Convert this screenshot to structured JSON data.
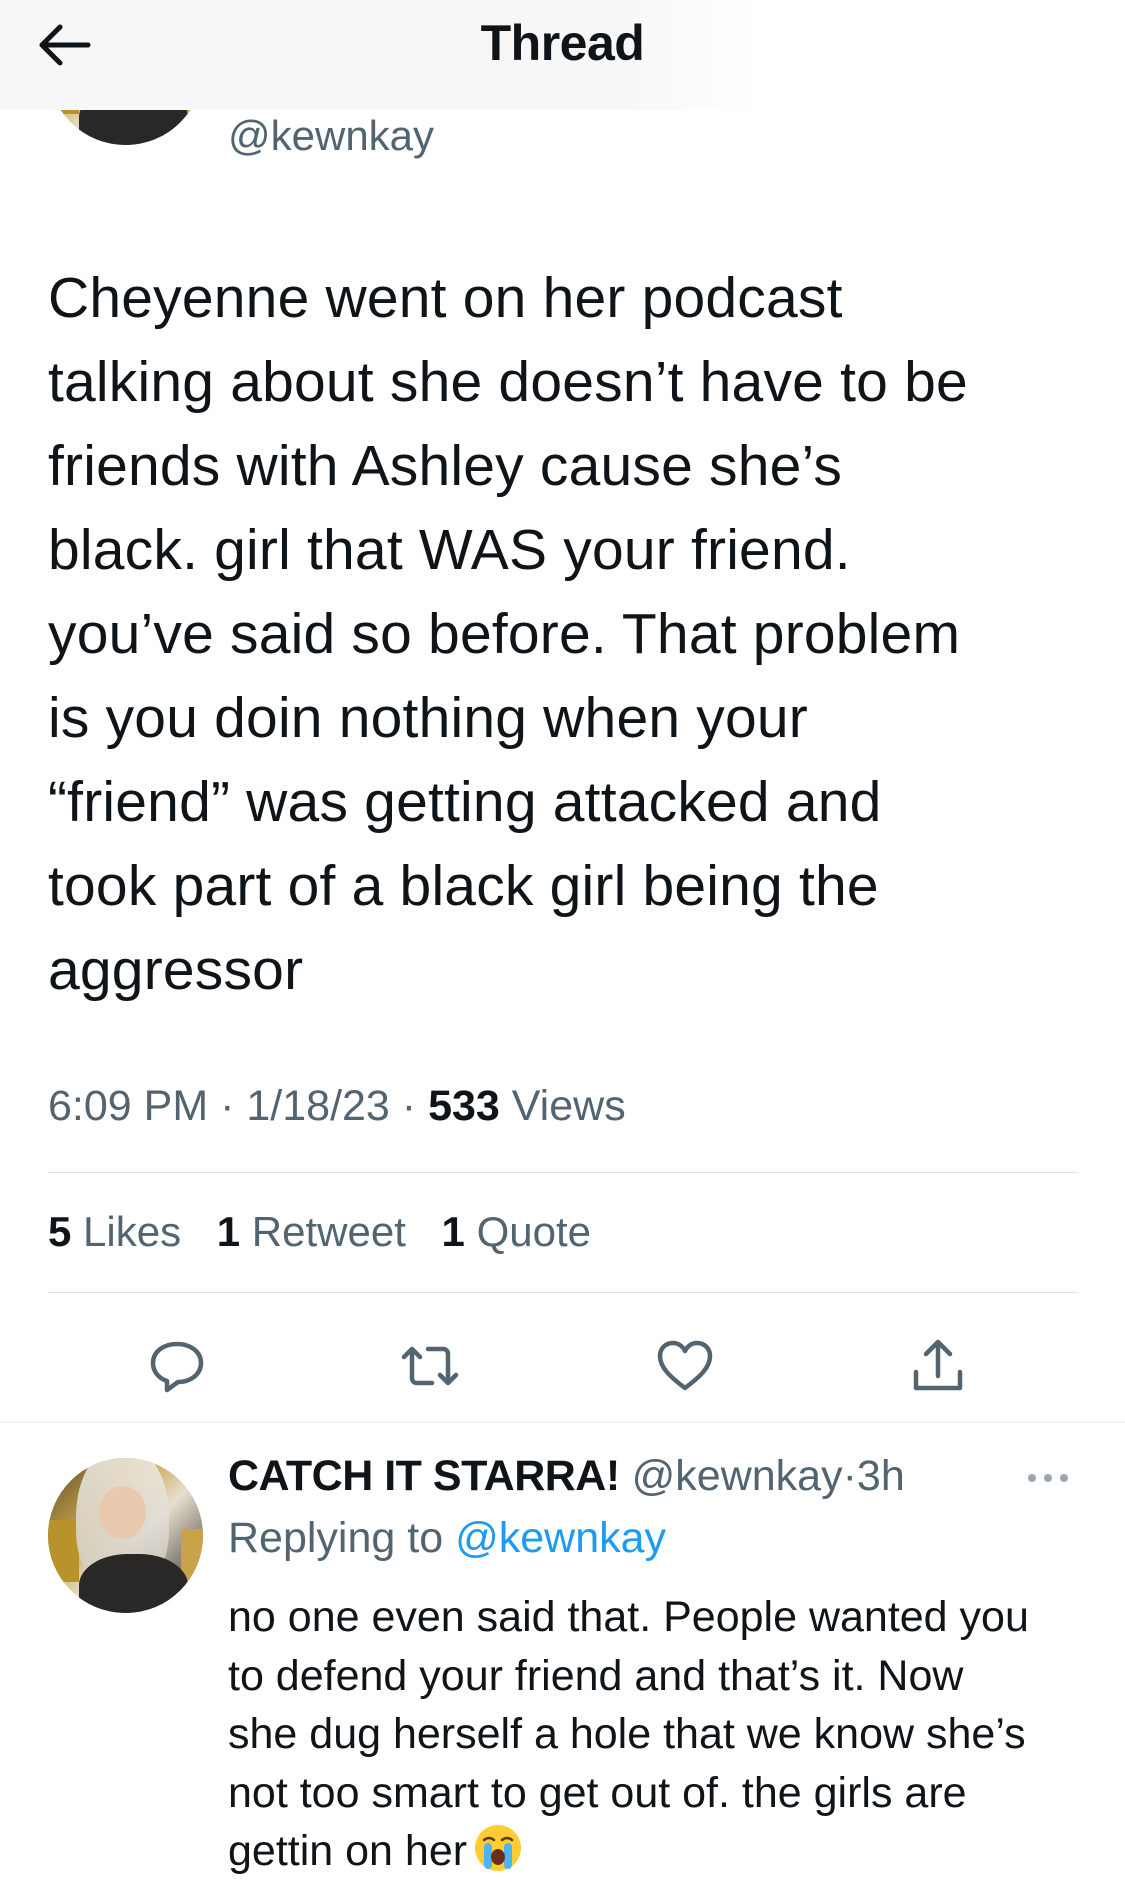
{
  "header": {
    "title": "Thread"
  },
  "tweet": {
    "handle": "@kewnkay",
    "text_lines": [
      "Cheyenne went on her podcast",
      "talking about she doesn’t have to be",
      "friends with Ashley cause she’s",
      "black. girl that WAS your friend.",
      "you’ve said so before. That problem",
      "is you doin nothing when your",
      "“friend” was getting attacked and",
      "took part of a black girl being the",
      "aggressor"
    ],
    "time": "6:09 PM",
    "date": "1/18/23",
    "views_count": "533",
    "views_label": "Views",
    "likes_count": "5",
    "likes_label": "Likes",
    "retweets_count": "1",
    "retweets_label": "Retweet",
    "quotes_count": "1",
    "quotes_label": "Quote"
  },
  "actions": [
    {
      "name": "reply",
      "icon": "reply-icon"
    },
    {
      "name": "retweet",
      "icon": "retweet-icon"
    },
    {
      "name": "like",
      "icon": "heart-icon"
    },
    {
      "name": "share",
      "icon": "share-icon"
    }
  ],
  "reply": {
    "display_name": "CATCH IT STARRA!",
    "handle": "@kewnkay",
    "separator": "·",
    "time_ago": "3h",
    "replying_prefix": "Replying to",
    "replying_to": "@kewnkay",
    "text_lines": [
      "no one even said that. People wanted you",
      "to defend your friend and that’s it. Now",
      "she dug herself a hole that we know she’s",
      "not too smart to get out of. the girls are",
      "gettin on her"
    ],
    "emoji": "loudly-crying-face-emoji"
  },
  "colors": {
    "accent": "#1d9bf0",
    "secondary_text": "#536471",
    "primary_text": "#0f1419"
  }
}
